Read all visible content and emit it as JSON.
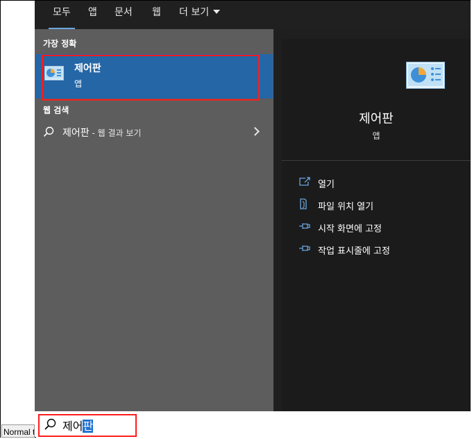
{
  "tabs": [
    {
      "label": "모두",
      "active": true
    },
    {
      "label": "앱"
    },
    {
      "label": "문서"
    },
    {
      "label": "웹"
    },
    {
      "label": "더 보기"
    }
  ],
  "left_panel": {
    "best_match_title": "가장 정확",
    "best_match": {
      "name": "제어판",
      "type": "앱",
      "icon": "control-panel-icon"
    },
    "web_search_title": "웹 검색",
    "web_result": {
      "query": "제어판",
      "suffix": " - 웹 결과 보기",
      "icon": "search-icon"
    }
  },
  "right_panel": {
    "app_name": "제어판",
    "app_type": "앱",
    "actions": [
      {
        "label": "열기",
        "icon": "open-icon"
      },
      {
        "label": "파일 위치 열기",
        "icon": "file-location-icon"
      },
      {
        "label": "시작 화면에 고정",
        "icon": "pin-icon"
      },
      {
        "label": "작업 표시줄에 고정",
        "icon": "pin-icon"
      }
    ]
  },
  "search": {
    "typed": "제어",
    "selected": "판"
  },
  "background_label": "Normal t",
  "colors": {
    "accent": "#2566a6",
    "highlight_border": "#ff1c1c",
    "selection": "#1f6fd1"
  }
}
